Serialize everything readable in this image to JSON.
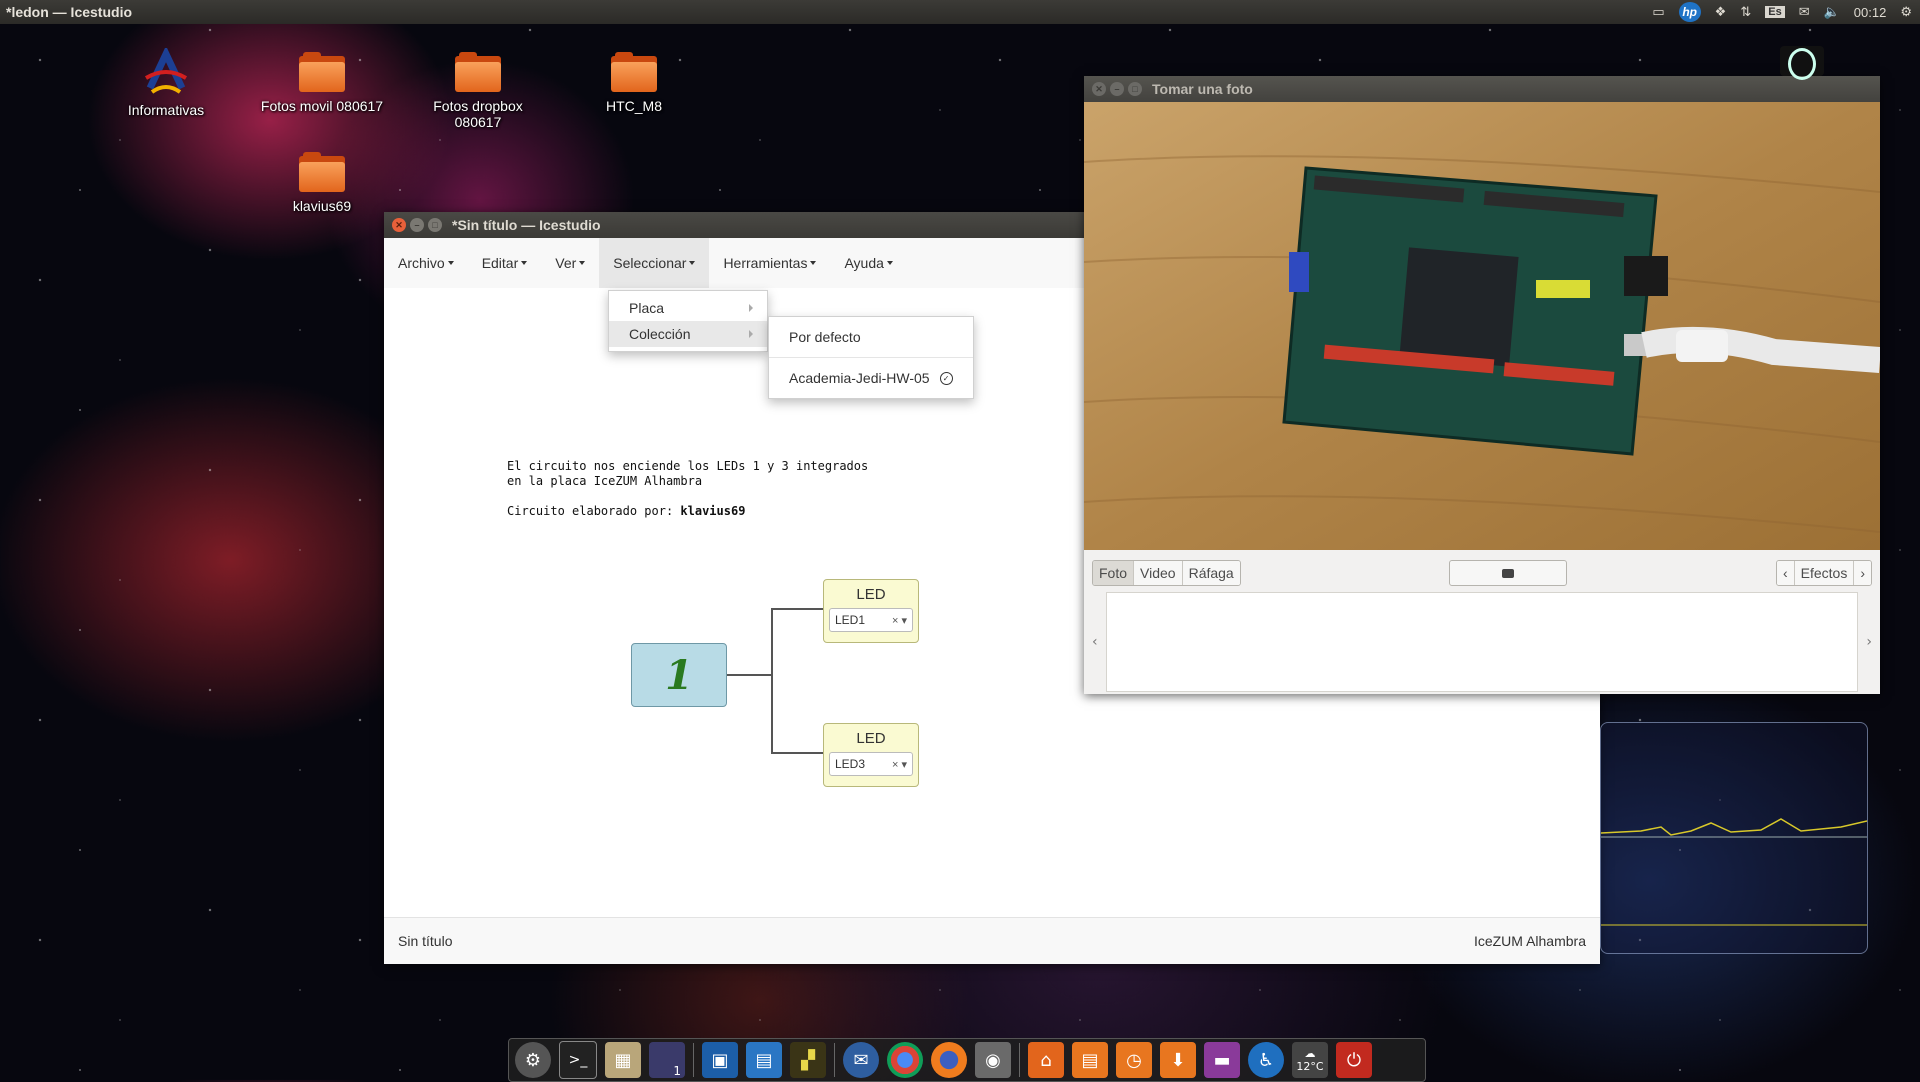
{
  "top_panel": {
    "title": "*ledon — Icestudio",
    "clock": "00:12",
    "keyboard_layout": "Es"
  },
  "desktop_icons": [
    {
      "label": "Informativas"
    },
    {
      "label": "Fotos movil 080617"
    },
    {
      "label": "Fotos dropbox 080617"
    },
    {
      "label": "HTC_M8"
    },
    {
      "label": "klavius69"
    }
  ],
  "icestudio": {
    "title": "*Sin título — Icestudio",
    "menu": [
      "Archivo",
      "Editar",
      "Ver",
      "Seleccionar",
      "Herramientas",
      "Ayuda"
    ],
    "select_menu": [
      "Placa",
      "Colección"
    ],
    "collection_submenu": [
      "Por defecto",
      "Academia-Jedi-HW-05"
    ],
    "comment_lines": [
      "El circuito nos enciende los LEDs 1 y 3 integrados",
      "en la placa IceZUM Alhambra"
    ],
    "comment_author_label": "Circuito elaborado por:",
    "comment_author": "klavius69",
    "constant_value": "1",
    "led_blocks": [
      {
        "title": "LED",
        "pin": "LED1"
      },
      {
        "title": "LED",
        "pin": "LED3"
      }
    ],
    "status_left": "Sin título",
    "status_right": "IceZUM Alhambra"
  },
  "camera": {
    "title": "Tomar una foto",
    "modes": [
      "Foto",
      "Video",
      "Ráfaga"
    ],
    "active_mode": "Foto",
    "effects_label": "Efectos"
  },
  "dock": {
    "weather_temp": "12°C",
    "workspace_badge": "1"
  },
  "colors": {
    "panel": "#3c3b37",
    "close_button": "#e8603a",
    "led_block": "#fafad2",
    "constant_block": "#b8dbe6",
    "folder": "#e8761f"
  }
}
